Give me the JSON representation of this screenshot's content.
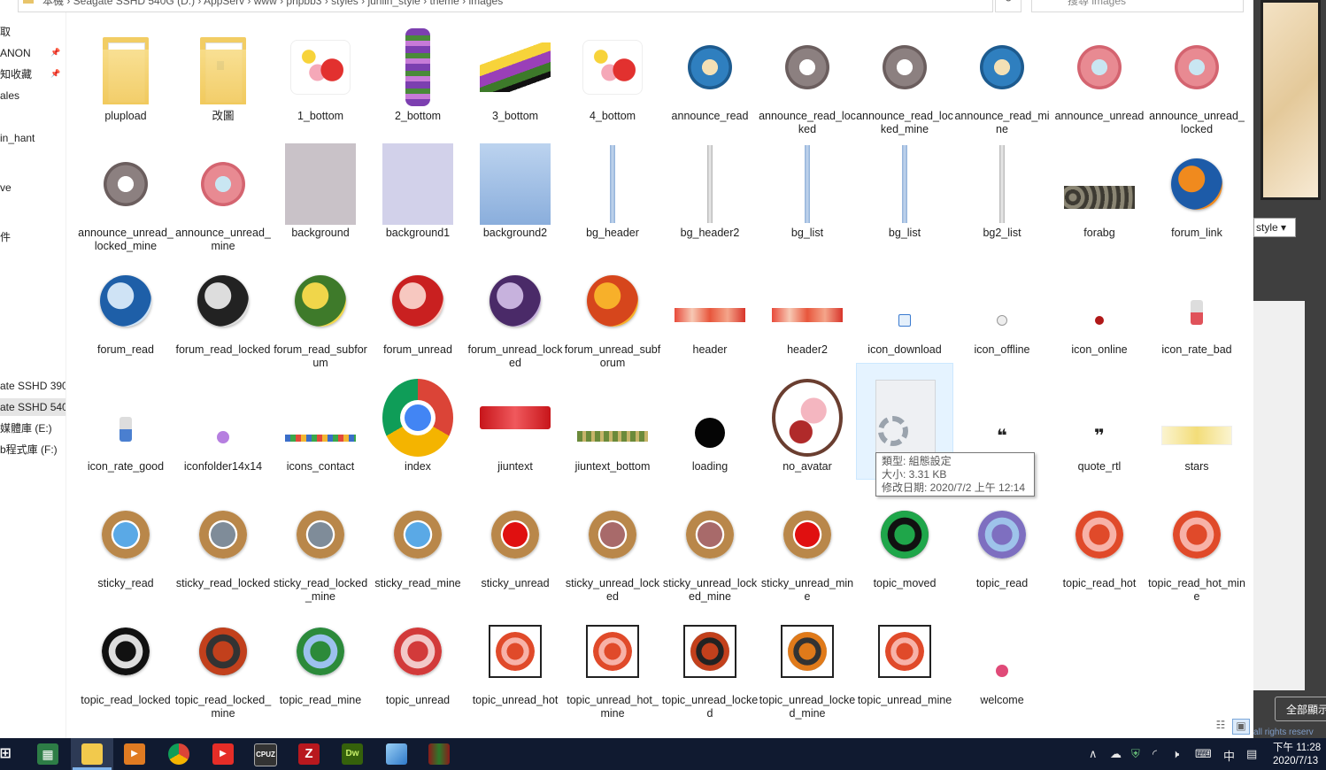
{
  "address_bar": {
    "path": "本機 › Seagate SSHD 540G (D:) › AppServ › www › phpbb3 › styles › junlin_style › theme › images",
    "search_placeholder": "搜尋 images"
  },
  "nav": {
    "items": [
      "取",
      "ANON",
      "知收藏",
      "ales",
      "in_hant",
      "ve",
      "件",
      "ate SSHD 390",
      "ate SSHD 540",
      "媒體庫 (E:)",
      "b程式庫 (F:)"
    ]
  },
  "files": [
    {
      "name": "plupload",
      "kind": "folder"
    },
    {
      "name": "改圖",
      "kind": "folder2"
    },
    {
      "name": "1_bottom",
      "kind": "flower"
    },
    {
      "name": "2_bottom",
      "kind": "vine"
    },
    {
      "name": "3_bottom",
      "kind": "fan"
    },
    {
      "name": "4_bottom",
      "kind": "flower"
    },
    {
      "name": "announce_read",
      "kind": "mandala-blue"
    },
    {
      "name": "announce_read_locked",
      "kind": "mandala-gray"
    },
    {
      "name": "announce_read_locked_mine",
      "kind": "mandala-gray"
    },
    {
      "name": "announce_read_mine",
      "kind": "mandala-blue"
    },
    {
      "name": "announce_unread",
      "kind": "mandala-pink"
    },
    {
      "name": "announce_unread_locked",
      "kind": "mandala-pink"
    },
    {
      "name": "announce_unread_locked_mine",
      "kind": "mandala-gray"
    },
    {
      "name": "announce_unread_mine",
      "kind": "mandala-pink"
    },
    {
      "name": "background",
      "kind": "bg-gray"
    },
    {
      "name": "background1",
      "kind": "bg-lav"
    },
    {
      "name": "background2",
      "kind": "bg-blue"
    },
    {
      "name": "bg_header",
      "kind": "bar-blue"
    },
    {
      "name": "bg_header2",
      "kind": "bar-gray"
    },
    {
      "name": "bg_list",
      "kind": "bar-blue"
    },
    {
      "name": "bg_list",
      "kind": "bar-blue"
    },
    {
      "name": "bg2_list",
      "kind": "bar-gray"
    },
    {
      "name": "forabg",
      "kind": "strip-dark"
    },
    {
      "name": "forum_link",
      "kind": "orb-mix"
    },
    {
      "name": "forum_read",
      "kind": "orb-blue"
    },
    {
      "name": "forum_read_locked",
      "kind": "orb-bw"
    },
    {
      "name": "forum_read_subforum",
      "kind": "orb-green"
    },
    {
      "name": "forum_unread",
      "kind": "orb-red"
    },
    {
      "name": "forum_unread_locked",
      "kind": "orb-purple"
    },
    {
      "name": "forum_unread_subforum",
      "kind": "orb-orange"
    },
    {
      "name": "header",
      "kind": "strip-red"
    },
    {
      "name": "header2",
      "kind": "strip-red"
    },
    {
      "name": "icon_download",
      "kind": "tiny-down"
    },
    {
      "name": "icon_offline",
      "kind": "tiny-offline"
    },
    {
      "name": "icon_online",
      "kind": "tiny-online"
    },
    {
      "name": "icon_rate_bad",
      "kind": "tiny-bad"
    },
    {
      "name": "icon_rate_good",
      "kind": "tiny-good"
    },
    {
      "name": "iconfolder14x14",
      "kind": "tiny-purple"
    },
    {
      "name": "icons_contact",
      "kind": "strip-contact"
    },
    {
      "name": "index",
      "kind": "chrome"
    },
    {
      "name": "jiuntext",
      "kind": "logo-text"
    },
    {
      "name": "jiuntext_bottom",
      "kind": "strip-green"
    },
    {
      "name": "loading",
      "kind": "loading"
    },
    {
      "name": "no_avatar",
      "kind": "avatar"
    },
    {
      "name": "",
      "kind": "config"
    },
    {
      "name": "",
      "kind": "quote-ltr"
    },
    {
      "name": "quote_rtl",
      "kind": "quote"
    },
    {
      "name": "stars",
      "kind": "stars"
    },
    {
      "name": "sticky_read",
      "kind": "medal-blue"
    },
    {
      "name": "sticky_read_locked",
      "kind": "medal-gray"
    },
    {
      "name": "sticky_read_locked_mine",
      "kind": "medal-gray"
    },
    {
      "name": "sticky_read_mine",
      "kind": "medal-blue"
    },
    {
      "name": "sticky_unread",
      "kind": "medal-red"
    },
    {
      "name": "sticky_unread_locked",
      "kind": "medal-rose"
    },
    {
      "name": "sticky_unread_locked_mine",
      "kind": "medal-rose"
    },
    {
      "name": "sticky_unread_mine",
      "kind": "medal-red"
    },
    {
      "name": "topic_moved",
      "kind": "topic-green"
    },
    {
      "name": "topic_read",
      "kind": "topic-blue"
    },
    {
      "name": "topic_read_hot",
      "kind": "topic-hot"
    },
    {
      "name": "topic_read_hot_mine",
      "kind": "topic-hot"
    },
    {
      "name": "topic_read_locked",
      "kind": "topic-bw"
    },
    {
      "name": "topic_read_locked_mine",
      "kind": "topic-brown"
    },
    {
      "name": "topic_read_mine",
      "kind": "topic-green2"
    },
    {
      "name": "topic_unread",
      "kind": "topic-pink"
    },
    {
      "name": "topic_unread_hot",
      "kind": "sq-hot"
    },
    {
      "name": "topic_unread_hot_mine",
      "kind": "sq-hot"
    },
    {
      "name": "topic_unread_locked",
      "kind": "sq-dark"
    },
    {
      "name": "topic_unread_locked_mine",
      "kind": "sq-orange"
    },
    {
      "name": "topic_unread_mine",
      "kind": "sq-hot"
    },
    {
      "name": "welcome",
      "kind": "tiny-welcome"
    }
  ],
  "tooltip": {
    "type_line": "類型: 組態設定",
    "size_line": "大小: 3.31 KB",
    "date_line": "修改日期: 2020/7/2 上午 12:14"
  },
  "right_pane": {
    "select_value": "style",
    "button_label": "全部顯示",
    "rights_text": "all rights reserv"
  },
  "taskbar": {
    "ime": "中",
    "time": "下午 11:28",
    "date": "2020/7/13",
    "cpuz_label": "CPUZ",
    "dw_label": "Dw"
  }
}
